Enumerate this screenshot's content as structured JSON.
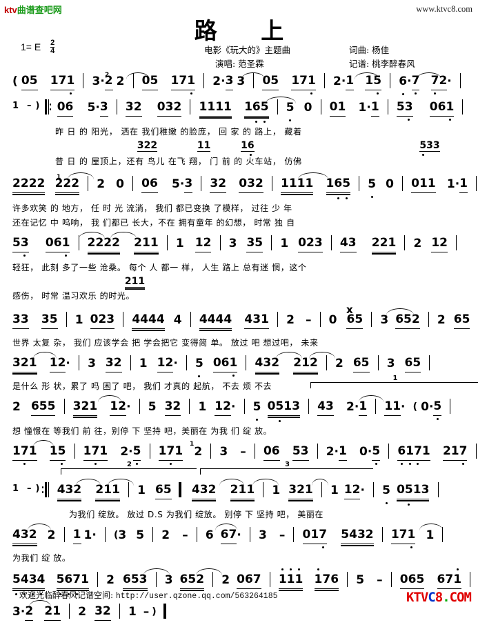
{
  "watermark": {
    "site_tag_k": "ktv",
    "site_tag_rest": "曲谱查吧网",
    "site_url": "www.ktvc8.com",
    "logo_ktv": "KTV",
    "logo_c": "C",
    "logo_8": "8",
    "logo_dot": ".",
    "logo_com": "COM"
  },
  "header": {
    "title": "路 上",
    "key_label": "1= E",
    "meter_numerator": "2",
    "meter_denominator": "4",
    "subtitle": "电影《玩大的》主题曲",
    "singer": "演唱: 范圣霖",
    "composer": "词曲: 杨佳",
    "notator": "记谱: 桃李醉春风"
  },
  "score": {
    "line1_notes": "( 05 171 | 3·2 2 | 05 171 | 2·3 3 | 05 171 | 2·1 15 | 6·7 72· |",
    "line1_tuplet": "2",
    "line2_notes": "1 - ) ‖: 06 5·3 | 32 032 | 1111 165 | 5 0 | 01 1·1 | 53 061 |",
    "line2_lyrics_v1": "昨 日 的 阳光， 洒在 我们稚嫩 的脸庞， 回 家 的 路上， 藏着",
    "line2_altnotes_a": "322",
    "line2_altnotes_b": "11",
    "line2_altnotes_c": "16",
    "line2_altnotes_d": "533",
    "line2_lyrics_v2": "昔 日 的 屋顶上，还有 鸟儿 在飞 翔， 门 前 的 火车站， 仿佛",
    "line3_notes": "2222 2·22 | 2 0 | 06 5·3 | 32 032 | 1111 165 | 5 0 | 011 1·1 |",
    "line3_tuplet": "1",
    "line3_lyrics_v1": "许多欢笑 的 地方， 任 时 光 流淌， 我们 都已变换 了模样， 过往 少 年",
    "line3_lyrics_v2": "还在记忆 中 呜响， 我 们都已 长大，不在 拥有童年 的幻想， 时常 独 自",
    "line4_notes": "53 061 | 2222 211 | 1 12 | 3 35 | 1 023 | 43 221 | 2 12 |",
    "line4_lyrics_v1": "轻狂， 此刻 多了一些 沧桑。 每个 人 都一 样， 人生 路上 总有迷 惘，这个",
    "line4_altnotes": "211",
    "line4_lyrics_v2": "感伤， 时常 温习欢乐 的时光。",
    "line5_notes": "33 35 | 1 023 | 4444 4 | 4444 431 | 2 - | 0 65 | 3 652 | 2 65 |",
    "line5_lyrics": "世界 太复 杂， 我们 应该学会 把 学会把它 变得简 单。 放过 吧 想过吧， 未来",
    "line6_notes": "321 12· | 3 32 | 1 12· | 5 061 | 432 212 | 2 65 | 3 65 |",
    "line6_lyrics": "是什么 形 状，累了 吗 困了 吧， 我们 才真的 起航， 不去 烦 不去",
    "line7_notes": "2 655 | 321 12· | 5 32 | 1 12· | 5 0513 | 43 2·1 | 11· ( 0·5 |",
    "line7_lyrics": "想 憧憬在 等我们 前 往，别停 下 坚持 吧，美丽在 为我 们 绽 放。",
    "line7_volta": "1",
    "line8_notes": "171 15 | 171 2·5 | 171 2 | 3 - | 06 53 | 2·1 0·5 | 6171 217 |",
    "line8_tuplet": "1",
    "line9_notes": "1 - ) ‖: 432 211 | 1 65 ‖ 432 211 | 1 321 | 1 12· | 5 0513 |",
    "line9_volta2": "2",
    "line9_volta3": "3",
    "line9_lyrics": "为我们 绽放。 放过 D.S 为我们 绽放。 别停 下 坚持 吧， 美丽在",
    "line10_notes": "432 2 | 1 1· | ( 3 5 | 2 - | 6 67· | 3 - | 017 5432 | 171 1 |",
    "line10_lyrics": "为我们 绽 放。",
    "line11_notes": "5434 5671 | 2 653 | 3 652 | 2 067 | 111 176 | 5 - | 065 671 |",
    "line12_notes": "3·2 21 | 2 32 | 1 - ) ‖"
  },
  "footer": {
    "text": "欢迎光临醉春风记谱空间:",
    "url": "http://user.qzone.qq.com/563264185"
  }
}
